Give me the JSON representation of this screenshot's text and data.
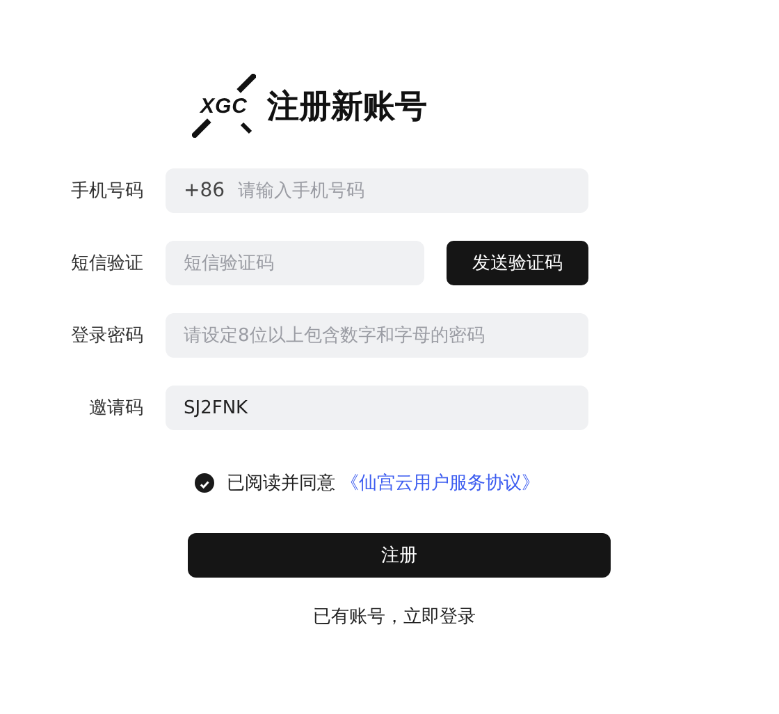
{
  "logo": {
    "text": "XGC"
  },
  "title": "注册新账号",
  "fields": [
    {
      "label": "手机号码",
      "prefix": "+86",
      "placeholder": "请输入手机号码"
    },
    {
      "label": "短信验证",
      "placeholder": "短信验证码",
      "button": "发送验证码"
    },
    {
      "label": "登录密码",
      "placeholder": "请设定8位以上包含数字和字母的密码"
    },
    {
      "label": "邀请码",
      "value": "SJ2FNK"
    }
  ],
  "agreement": {
    "checked": true,
    "text": "已阅读并同意",
    "link": "《仙宫云用户服务协议》"
  },
  "submit": "注册",
  "login_link": "已有账号，立即登录"
}
